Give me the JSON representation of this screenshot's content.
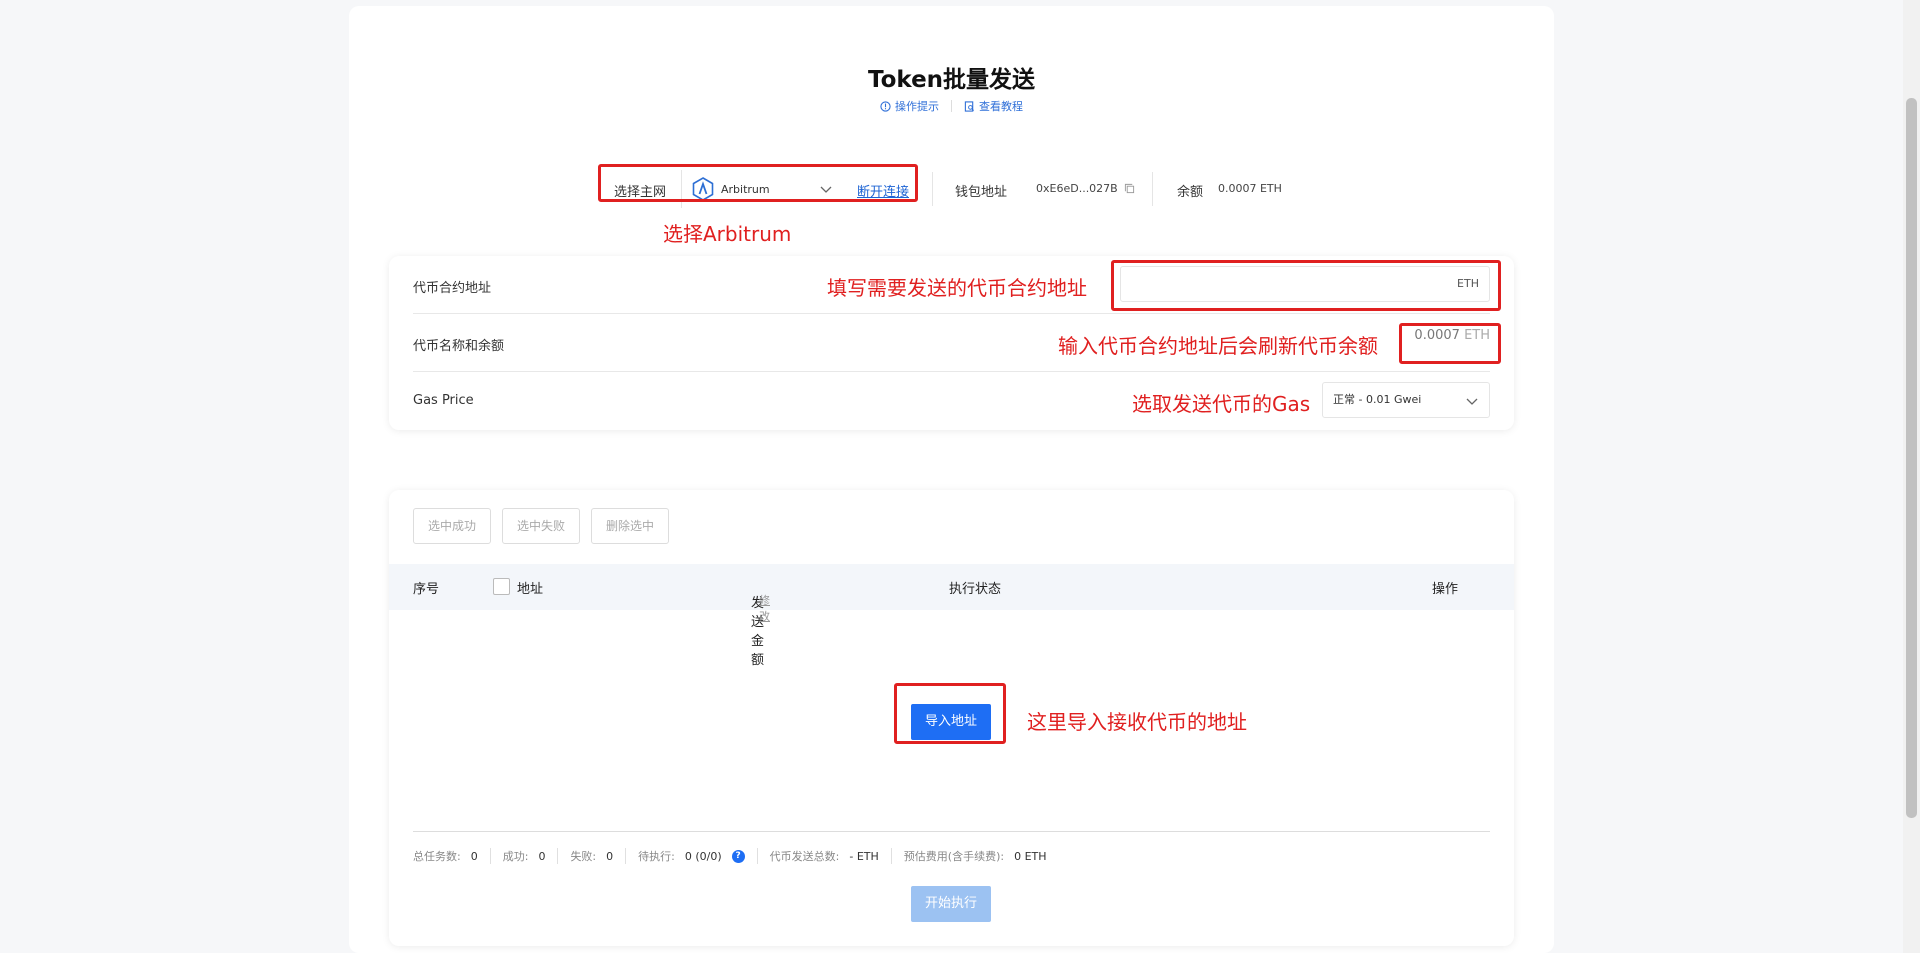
{
  "page": {
    "title": "Token批量发送",
    "tips_link": "操作提示",
    "tutorial_link": "查看教程"
  },
  "network": {
    "label": "选择主网",
    "selected": "Arbitrum",
    "disconnect": "断开连接",
    "wallet_label": "钱包地址",
    "wallet_address": "0xE6eD...027B",
    "balance_label": "余额",
    "balance_value": "0.0007 ETH"
  },
  "form": {
    "contract_label": "代币合约地址",
    "contract_unit": "ETH",
    "token_label": "代币名称和余额",
    "token_balance": "0.0007",
    "token_unit": "ETH",
    "gas_label": "Gas Price",
    "gas_value": "正常 - 0.01 Gwei"
  },
  "actions": {
    "select_success": "选中成功",
    "select_failed": "选中失败",
    "delete_selected": "删除选中"
  },
  "table": {
    "col_index": "序号",
    "col_address": "地址",
    "col_amount": "发送金额",
    "col_amount_edit": "修改",
    "col_status": "执行状态",
    "col_action": "操作"
  },
  "import_button": "导入地址",
  "stats": {
    "total_label": "总任务数:",
    "total": "0",
    "success_label": "成功:",
    "success": "0",
    "fail_label": "失败:",
    "fail": "0",
    "pending_label": "待执行:",
    "pending": "0 (0/0)",
    "sent_label": "代币发送总数:",
    "sent": "- ETH",
    "fee_label": "预估费用(含手续费):",
    "fee": "0 ETH"
  },
  "start_button": "开始执行",
  "annotations": {
    "select_network": "选择Arbitrum",
    "fill_contract": "填写需要发送的代币合约地址",
    "refresh_balance": "输入代币合约地址后会刷新代币余额",
    "select_gas": "选取发送代币的Gas",
    "import_here": "这里导入接收代币的地址"
  },
  "colors": {
    "accent": "#1e6ef4",
    "annotation": "#e02020"
  }
}
